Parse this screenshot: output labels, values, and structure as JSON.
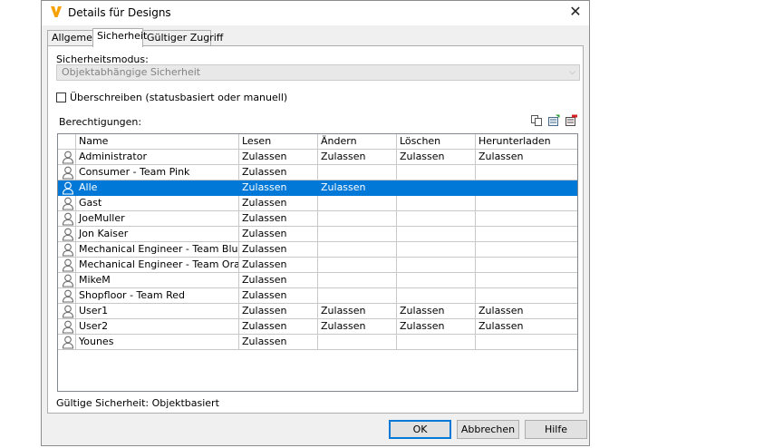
{
  "window": {
    "title": "Details für Designs",
    "close_glyph": "✕",
    "app_icon": "vault-logo-icon",
    "accent_color": "#f5a100"
  },
  "tabs": [
    {
      "label": "Allgemein",
      "active": false
    },
    {
      "label": "Sicherheit",
      "active": true
    },
    {
      "label": "Gültiger Zugriff",
      "active": false
    }
  ],
  "security": {
    "mode_label": "Sicherheitsmodus:",
    "mode_value": "Objektabhängige Sicherheit",
    "override_label": "Überschreiben (statusbasiert oder manuell)",
    "override_checked": false,
    "permissions_label": "Berechtigungen:",
    "toolbar_icons": [
      "copy-icon",
      "add-icon",
      "remove-icon"
    ]
  },
  "grid": {
    "columns": [
      "Name",
      "Lesen",
      "Ändern",
      "Löschen",
      "Herunterladen"
    ],
    "selected_row": 2,
    "selection_color": "#0078d7",
    "rows": [
      {
        "name": "Administrator",
        "lesen": "Zulassen",
        "aendern": "Zulassen",
        "loeschen": "Zulassen",
        "herunterladen": "Zulassen"
      },
      {
        "name": "Consumer - Team Pink",
        "lesen": "Zulassen",
        "aendern": "",
        "loeschen": "",
        "herunterladen": ""
      },
      {
        "name": "Alle",
        "lesen": "Zulassen",
        "aendern": "Zulassen",
        "loeschen": "",
        "herunterladen": ""
      },
      {
        "name": "Gast",
        "lesen": "Zulassen",
        "aendern": "",
        "loeschen": "",
        "herunterladen": ""
      },
      {
        "name": "JoeMuller",
        "lesen": "Zulassen",
        "aendern": "",
        "loeschen": "",
        "herunterladen": ""
      },
      {
        "name": "Jon Kaiser",
        "lesen": "Zulassen",
        "aendern": "",
        "loeschen": "",
        "herunterladen": ""
      },
      {
        "name": "Mechanical Engineer - Team Blue",
        "lesen": "Zulassen",
        "aendern": "",
        "loeschen": "",
        "herunterladen": ""
      },
      {
        "name": "Mechanical Engineer - Team Orange",
        "lesen": "Zulassen",
        "aendern": "",
        "loeschen": "",
        "herunterladen": ""
      },
      {
        "name": "MikeM",
        "lesen": "Zulassen",
        "aendern": "",
        "loeschen": "",
        "herunterladen": ""
      },
      {
        "name": "Shopfloor - Team Red",
        "lesen": "Zulassen",
        "aendern": "",
        "loeschen": "",
        "herunterladen": ""
      },
      {
        "name": "User1",
        "lesen": "Zulassen",
        "aendern": "Zulassen",
        "loeschen": "Zulassen",
        "herunterladen": "Zulassen"
      },
      {
        "name": "User2",
        "lesen": "Zulassen",
        "aendern": "Zulassen",
        "loeschen": "Zulassen",
        "herunterladen": "Zulassen"
      },
      {
        "name": "Younes",
        "lesen": "Zulassen",
        "aendern": "",
        "loeschen": "",
        "herunterladen": ""
      }
    ]
  },
  "status": {
    "text": "Gültige Sicherheit: Objektbasiert"
  },
  "buttons": {
    "ok": "OK",
    "cancel": "Abbrechen",
    "help": "Hilfe"
  }
}
